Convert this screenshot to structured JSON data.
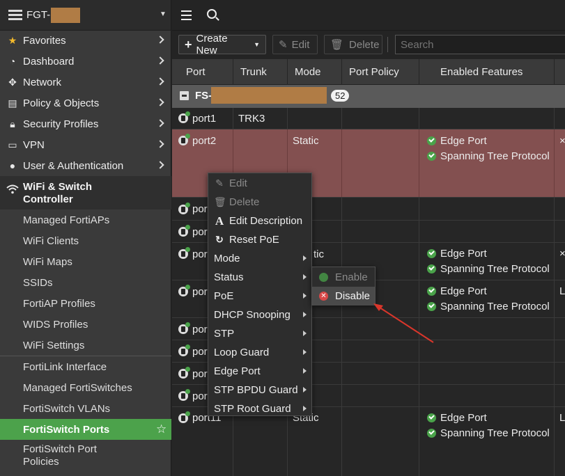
{
  "app": {
    "hostname_prefix": "FGT-"
  },
  "sidebar": {
    "items": [
      {
        "label": "Favorites",
        "icon": "star-icon"
      },
      {
        "label": "Dashboard",
        "icon": "dashboard-icon"
      },
      {
        "label": "Network",
        "icon": "network-icon"
      },
      {
        "label": "Policy & Objects",
        "icon": "policy-icon"
      },
      {
        "label": "Security Profiles",
        "icon": "lock-icon"
      },
      {
        "label": "VPN",
        "icon": "laptop-icon"
      },
      {
        "label": "User & Authentication",
        "icon": "user-icon"
      }
    ],
    "expanded_group": {
      "label_line1": "WiFi & Switch",
      "label_line2": "Controller",
      "icon": "wifi-icon"
    },
    "sub_items": [
      "Managed FortiAPs",
      "WiFi Clients",
      "WiFi Maps",
      "SSIDs",
      "FortiAP Profiles",
      "WIDS Profiles",
      "WiFi Settings",
      "FortiLink Interface",
      "Managed FortiSwitches",
      "FortiSwitch VLANs",
      "FortiSwitch Ports",
      "FortiSwitch Port"
    ],
    "sub_item_last_line2": "Policies",
    "active_item": "FortiSwitch Ports"
  },
  "toolbar": {
    "create_new": "Create New",
    "edit": "Edit",
    "delete": "Delete",
    "search_placeholder": "Search"
  },
  "table": {
    "columns": [
      "Port",
      "Trunk",
      "Mode",
      "Port Policy",
      "Enabled Features"
    ],
    "group": {
      "name_prefix": "FS-",
      "count": "52"
    },
    "rows": [
      {
        "port": "port1",
        "trunk": "TRK3",
        "mode": "",
        "features": []
      },
      {
        "port": "port2",
        "trunk": "",
        "mode": "Static",
        "features": [
          "Edge Port",
          "Spanning Tree Protocol"
        ],
        "selected": true,
        "extra": "×"
      },
      {
        "port": "port3",
        "trunk": "",
        "mode": "",
        "features": []
      },
      {
        "port": "port4",
        "trunk": "",
        "mode": "",
        "features": []
      },
      {
        "port": "port5",
        "trunk": "",
        "mode": "Static",
        "features": [
          "Edge Port",
          "Spanning Tree Protocol"
        ],
        "extra": "×"
      },
      {
        "port": "port6",
        "trunk": "",
        "mode": "",
        "features": [
          "Edge Port",
          "Spanning Tree Protocol"
        ],
        "extra": "L"
      },
      {
        "port": "port7",
        "trunk": "",
        "mode": "",
        "features": []
      },
      {
        "port": "port8",
        "trunk": "",
        "mode": "",
        "features": []
      },
      {
        "port": "port9",
        "trunk": "",
        "mode": "",
        "features": []
      },
      {
        "port": "port10",
        "trunk": "",
        "mode": "",
        "features": []
      },
      {
        "port": "port11",
        "trunk": "",
        "mode": "Static",
        "features": [
          "Edge Port",
          "Spanning Tree Protocol"
        ],
        "extra": "L"
      }
    ],
    "visible_partial_port_label": "por",
    "visible_partial_mode_label": "tic"
  },
  "context_menu": {
    "items": [
      {
        "label": "Edit",
        "icon": "pencil-icon",
        "disabled": true
      },
      {
        "label": "Delete",
        "icon": "trash-icon",
        "disabled": true
      },
      {
        "label": "Edit Description",
        "icon": "text-icon"
      },
      {
        "label": "Reset PoE",
        "icon": "refresh-icon"
      },
      {
        "label": "Mode",
        "submenu": true
      },
      {
        "label": "Status",
        "submenu": true
      },
      {
        "label": "PoE",
        "submenu": true
      },
      {
        "label": "DHCP Snooping",
        "submenu": true
      },
      {
        "label": "STP",
        "submenu": true
      },
      {
        "label": "Loop Guard",
        "submenu": true
      },
      {
        "label": "Edge Port",
        "submenu": true
      },
      {
        "label": "STP BPDU Guard",
        "submenu": true
      },
      {
        "label": "STP Root Guard",
        "submenu": true
      }
    ],
    "status_submenu": [
      {
        "label": "Enable",
        "disabled": true
      },
      {
        "label": "Disable",
        "highlighted": true
      }
    ]
  },
  "colors": {
    "accent_green": "#4ca24b",
    "selected_row": "#835050",
    "annotation_arrow": "#d9362b",
    "redaction": "#b07c45"
  }
}
